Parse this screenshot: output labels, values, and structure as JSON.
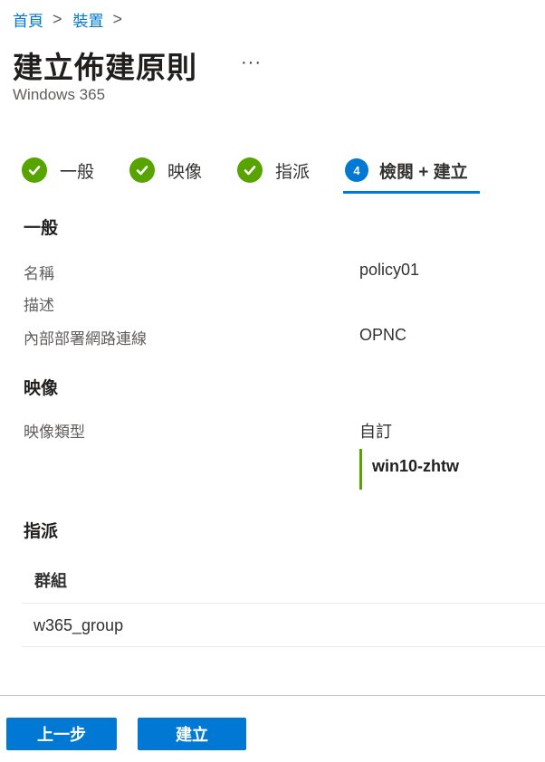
{
  "breadcrumb": {
    "items": [
      "首頁",
      "裝置"
    ],
    "separator": ">"
  },
  "header": {
    "title": "建立佈建原則",
    "more": "···",
    "subtitle": "Windows 365"
  },
  "steps": [
    {
      "label": "一般",
      "state": "done",
      "icon": "check-icon"
    },
    {
      "label": "映像",
      "state": "done",
      "icon": "check-icon"
    },
    {
      "label": "指派",
      "state": "done",
      "icon": "check-icon"
    },
    {
      "number": "4",
      "label": "檢閱 + 建立",
      "state": "active"
    }
  ],
  "general": {
    "heading": "一般",
    "name_label": "名稱",
    "name_value": "policy01",
    "desc_label": "描述",
    "network_label": "內部部署網路連線",
    "network_value": "OPNC"
  },
  "image": {
    "heading": "映像",
    "type_label": "映像類型",
    "type_value": "自訂",
    "image_name": "win10-zhtw"
  },
  "assignment": {
    "heading": "指派",
    "column_header": "群組",
    "rows": [
      "w365_group"
    ]
  },
  "footer": {
    "prev_label": "上一步",
    "create_label": "建立"
  },
  "colors": {
    "accent": "#0078d4",
    "success": "#57a300"
  }
}
